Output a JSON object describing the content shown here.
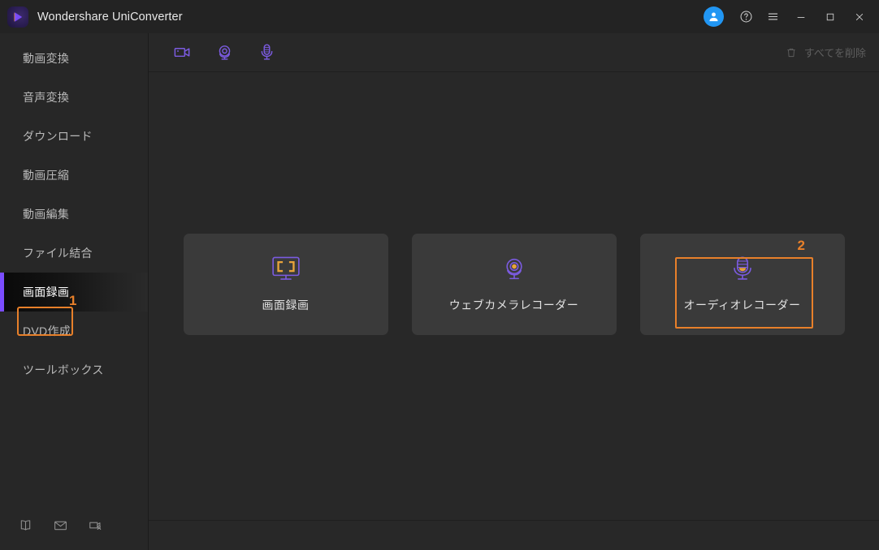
{
  "window": {
    "title": "Wondershare UniConverter",
    "logo_icon": "uniconverter-logo-icon",
    "controls": {
      "account_icon": "user-account-icon",
      "help_icon": "help-question-icon",
      "menu_icon": "hamburger-menu-icon",
      "minimize_icon": "minimize-icon",
      "maximize_icon": "maximize-icon",
      "close_icon": "close-icon"
    }
  },
  "sidebar": {
    "items": [
      {
        "label": "動画変換",
        "active": false
      },
      {
        "label": "音声変換",
        "active": false
      },
      {
        "label": "ダウンロード",
        "active": false
      },
      {
        "label": "動画圧縮",
        "active": false
      },
      {
        "label": "動画編集",
        "active": false
      },
      {
        "label": "ファイル結合",
        "active": false
      },
      {
        "label": "画面録画",
        "active": true
      },
      {
        "label": "DVD作成",
        "active": false
      },
      {
        "label": "ツールボックス",
        "active": false
      }
    ],
    "footer_icons": [
      {
        "name": "book-icon"
      },
      {
        "name": "mail-icon"
      },
      {
        "name": "video-user-icon"
      }
    ]
  },
  "toolbar": {
    "icons": [
      {
        "name": "video-camera-icon"
      },
      {
        "name": "webcam-icon"
      },
      {
        "name": "microphone-icon"
      }
    ],
    "delete_all_label": "すべてを削除",
    "delete_all_icon": "trash-icon"
  },
  "main": {
    "cards": [
      {
        "label": "画面録画",
        "icon": "screen-monitor-icon"
      },
      {
        "label": "ウェブカメラレコーダー",
        "icon": "webcam-icon"
      },
      {
        "label": "オーディオレコーダー",
        "icon": "microphone-icon",
        "highlighted": true
      }
    ]
  },
  "annotations": [
    {
      "number": "1",
      "target": "画面録画",
      "color": "#e8802a"
    },
    {
      "number": "2",
      "target": "オーディオレコーダー",
      "color": "#e8802a"
    }
  ],
  "colors": {
    "accent_purple": "#7B4DFF",
    "annotation_orange": "#e8802a",
    "icon_orange": "#e8a33a",
    "avatar_blue": "#2196f3",
    "window_bg": "#272727",
    "card_bg": "#3a3a3a"
  }
}
